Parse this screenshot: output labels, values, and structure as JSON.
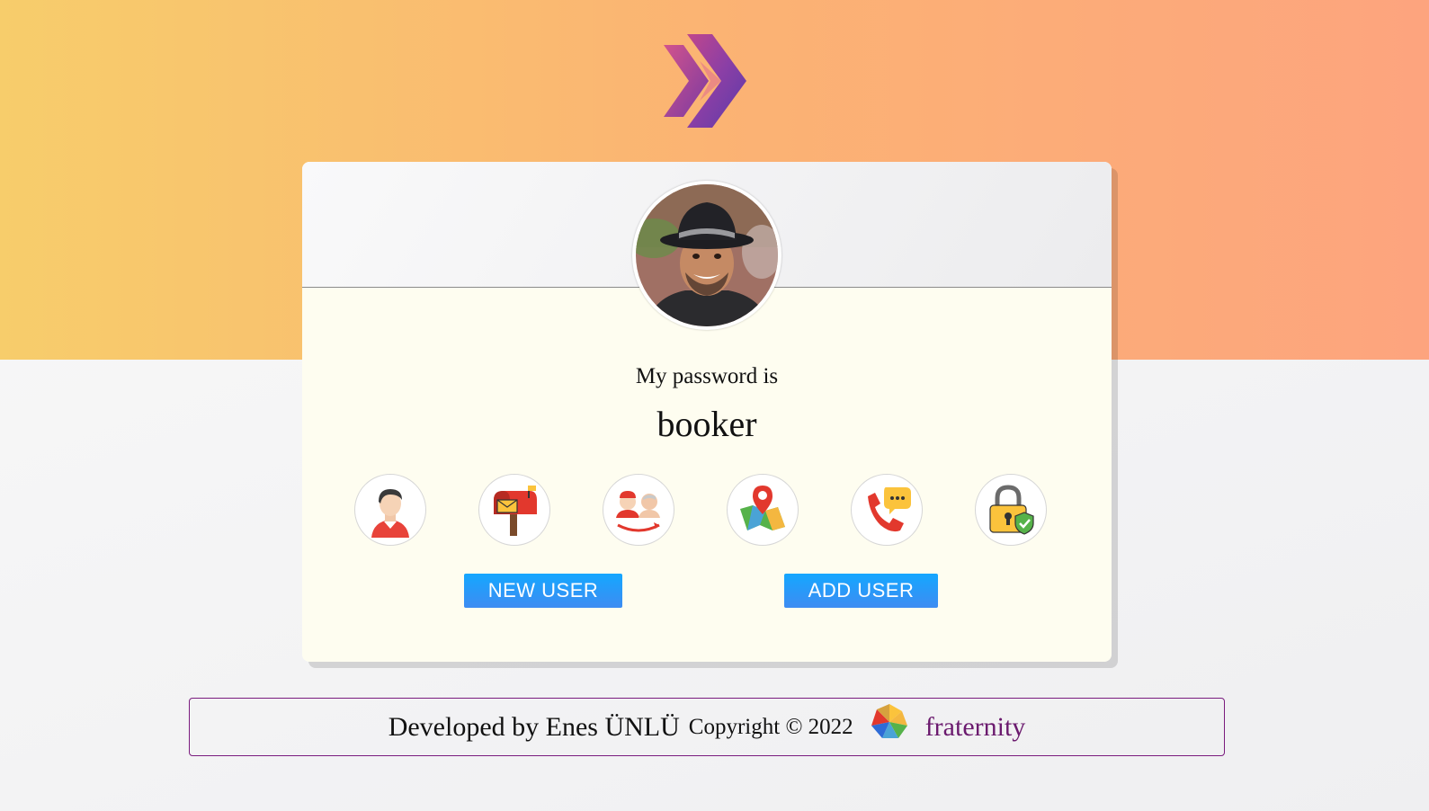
{
  "header": {
    "logo_icon": "chevron-logo-icon",
    "band_colors": [
      "#f7cd6b",
      "#fda47e"
    ]
  },
  "card": {
    "avatar_icon": "user-photo",
    "label": "My password is",
    "value": "booker",
    "icons": [
      {
        "name": "user-icon"
      },
      {
        "name": "mailbox-icon"
      },
      {
        "name": "age-icon"
      },
      {
        "name": "map-icon"
      },
      {
        "name": "phone-icon"
      },
      {
        "name": "lock-icon"
      }
    ],
    "buttons": {
      "new_user": "NEW USER",
      "add_user": "ADD USER"
    },
    "accent_color": "#14a7ff"
  },
  "footer": {
    "developed_by": "Developed by Enes ÜNLÜ",
    "copyright": "Copyright © 2022",
    "brand": "fraternity",
    "brand_color": "#6b1a6e"
  }
}
